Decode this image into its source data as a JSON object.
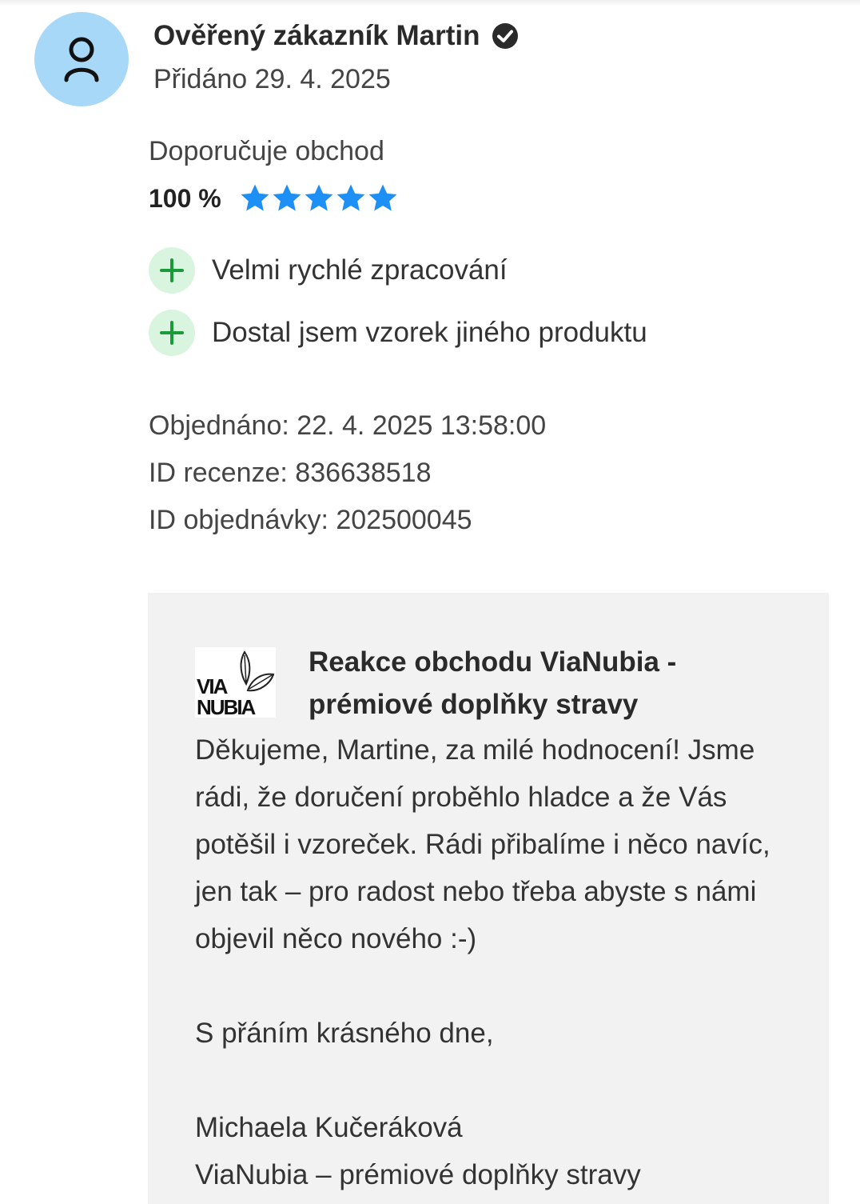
{
  "review": {
    "author": "Ověřený zákazník Martin",
    "added": "Přidáno 29. 4. 2025",
    "recommend_label": "Doporučuje obchod",
    "recommend_percent": "100 %",
    "stars": 5,
    "star_color": "#1e8ff5",
    "pros": [
      "Velmi rychlé zpracování",
      "Dostal jsem vzorek jiného produktu"
    ],
    "ordered": "Objednáno: 22. 4. 2025 13:58:00",
    "review_id": "ID recenze: 836638518",
    "order_id": "ID objednávky: 202500045"
  },
  "reply": {
    "logo_line1": "VIA",
    "logo_line2": "NUBIA",
    "title": "Reakce obchodu ViaNubia - prémiové doplňky stravy",
    "body": "Děkujeme, Martine, za milé hodnocení! Jsme rádi, že doručení proběhlo hladce a že Vás potěšil i vzoreček. Rádi přibalíme i něco navíc, jen tak – pro radost nebo třeba abyste s námi objevil něco nového :-)\n\nS přáním krásného dne,\n\nMichaela Kučeráková\nViaNubia – prémiové doplňky stravy"
  },
  "colors": {
    "avatar_bg": "#a8d8f8",
    "pro_bg": "#d9f5df",
    "pro_icon": "#1a9a3a",
    "reply_bg": "#f2f2f2"
  }
}
